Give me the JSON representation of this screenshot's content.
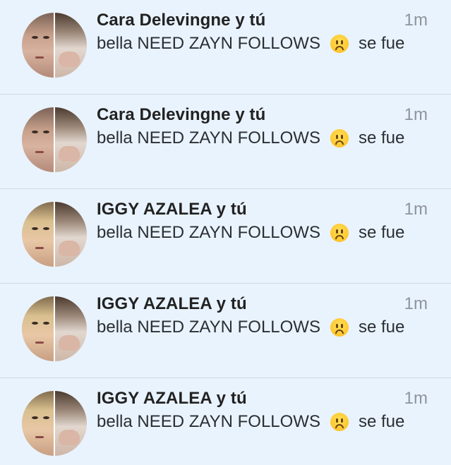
{
  "notifications": [
    {
      "sender": "Cara Delevingne y tú",
      "time": "1m",
      "message_text": "bella NEED ZAYN FOLLOWS",
      "emoji": "frowning-face",
      "message_tail": "se fue",
      "avatar": "cara"
    },
    {
      "sender": "Cara Delevingne y tú",
      "time": "1m",
      "message_text": "bella NEED ZAYN FOLLOWS",
      "emoji": "frowning-face",
      "message_tail": "se fue",
      "avatar": "cara"
    },
    {
      "sender": "IGGY AZALEA y tú",
      "time": "1m",
      "message_text": "bella NEED ZAYN FOLLOWS",
      "emoji": "frowning-face",
      "message_tail": "se fue",
      "avatar": "iggy"
    },
    {
      "sender": "IGGY AZALEA y tú",
      "time": "1m",
      "message_text": "bella NEED ZAYN FOLLOWS",
      "emoji": "frowning-face",
      "message_tail": "se fue",
      "avatar": "iggy"
    },
    {
      "sender": "IGGY AZALEA y tú",
      "time": "1m",
      "message_text": "bella NEED ZAYN FOLLOWS",
      "emoji": "frowning-face",
      "message_tail": "se fue",
      "avatar": "iggy"
    }
  ],
  "colors": {
    "background": "#e9f3fe",
    "divider": "#cfd8e2",
    "time_text": "#8e949b"
  }
}
